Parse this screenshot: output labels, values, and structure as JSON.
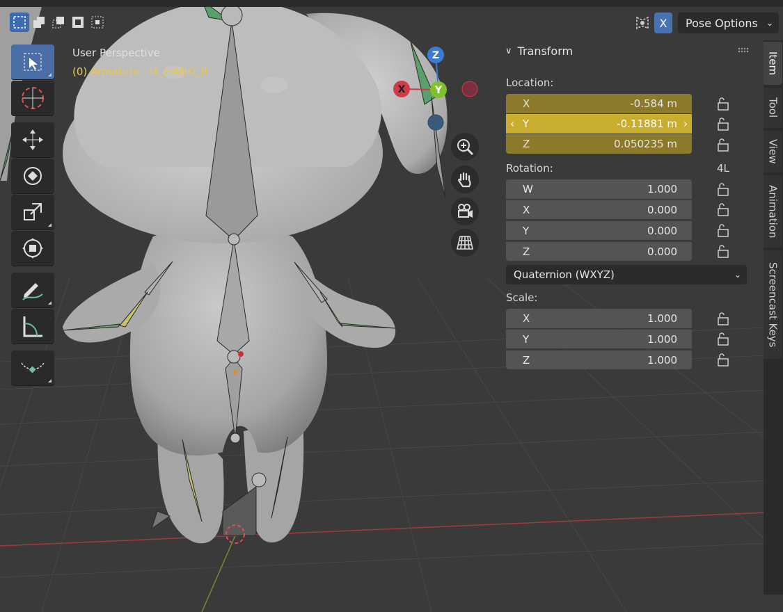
{
  "viewport": {
    "title": "User Perspective",
    "subtitle": "(0) Armature : IK_HAND_R"
  },
  "header": {
    "xray_label": "X",
    "pose_options_label": "Pose Options"
  },
  "toolbar": {
    "tools": [
      "select-box",
      "cursor",
      "move",
      "rotate",
      "scale",
      "transform",
      "annotate",
      "measure",
      "pose-breakdown"
    ]
  },
  "gizmo": {
    "x": "X",
    "y": "Y",
    "z": "Z"
  },
  "transform": {
    "title": "Transform",
    "location_label": "Location:",
    "location": [
      {
        "axis": "X",
        "value": "-0.584 m"
      },
      {
        "axis": "Y",
        "value": "-0.11881 m"
      },
      {
        "axis": "Z",
        "value": "0.050235 m"
      }
    ],
    "rotation_label": "Rotation:",
    "rotation_mode_badge": "4L",
    "rotation": [
      {
        "axis": "W",
        "value": "1.000"
      },
      {
        "axis": "X",
        "value": "0.000"
      },
      {
        "axis": "Y",
        "value": "0.000"
      },
      {
        "axis": "Z",
        "value": "0.000"
      }
    ],
    "rotation_mode": "Quaternion (WXYZ)",
    "scale_label": "Scale:",
    "scale": [
      {
        "axis": "X",
        "value": "1.000"
      },
      {
        "axis": "Y",
        "value": "1.000"
      },
      {
        "axis": "Z",
        "value": "1.000"
      }
    ]
  },
  "tabs": [
    "Item",
    "Tool",
    "View",
    "Animation",
    "Screencast Keys"
  ],
  "colors": {
    "accent": "#4a6ea8",
    "location_field": "#8a7a2a",
    "location_active": "#c9ad2e",
    "subtitle": "#e8c84a"
  }
}
